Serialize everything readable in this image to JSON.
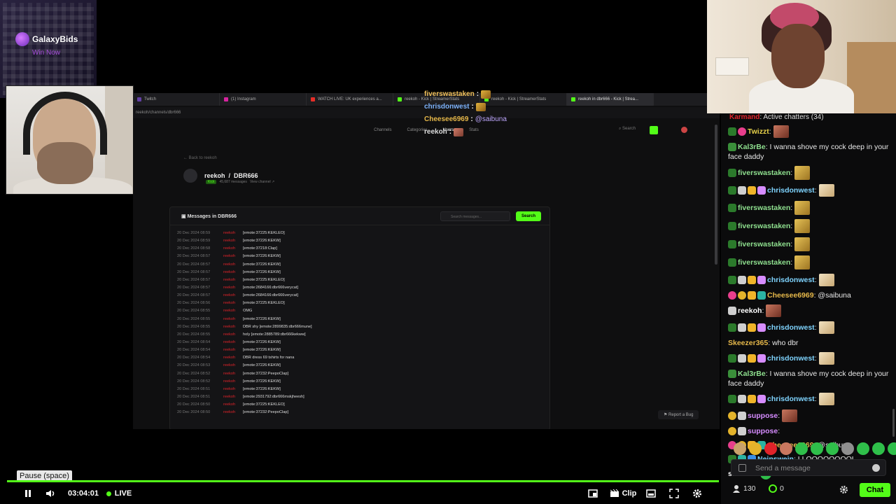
{
  "sponsor": {
    "name": "GalaxyBids",
    "tagline": "Win Now"
  },
  "capture": {
    "tabs": [
      {
        "label": "Twitch",
        "icon": "twitch"
      },
      {
        "label": "(1) Instagram",
        "icon": "instagram"
      },
      {
        "label": "WATCH LIVE: UK experiences a...",
        "icon": "youtube"
      },
      {
        "label": "reekoh - Kick | StreamerStats",
        "icon": "kick"
      },
      {
        "label": "reekoh - Kick | StreamerStats",
        "icon": "kick"
      },
      {
        "label": "reekoh in dbr666 - Kick | Strea...",
        "icon": "kick"
      }
    ],
    "address": "reekoh/channels/dbr666",
    "nav": [
      "Channels",
      "Categories",
      "Users",
      "Stats"
    ],
    "nav_active": "Users",
    "search_label": "Search",
    "back": "← Back to reekoh",
    "user": "reekoh",
    "channel": "DBR666",
    "platform_badge": "Kick",
    "message_count": "45,687 messages",
    "view_channel": "View channel ↗",
    "panel_title": "Messages in DBR666",
    "panel_search_placeholder": "Search messages...",
    "panel_search_button": "Search",
    "rows": [
      {
        "date": "20 Dec 2024 08:59",
        "user": "reekoh",
        "text": "[emote:37225:KEKLEO]"
      },
      {
        "date": "20 Dec 2024 08:59",
        "user": "reekoh",
        "text": "[emote:37226:KEKW]"
      },
      {
        "date": "20 Dec 2024 08:58",
        "user": "reekoh",
        "text": "[emote:37218:Clap]"
      },
      {
        "date": "20 Dec 2024 08:57",
        "user": "reekoh",
        "text": "[emote:37226:KEKW]"
      },
      {
        "date": "20 Dec 2024 08:57",
        "user": "reekoh",
        "text": "[emote:37226:KEKW]"
      },
      {
        "date": "20 Dec 2024 08:57",
        "user": "reekoh",
        "text": "[emote:37226:KEKW]"
      },
      {
        "date": "20 Dec 2024 08:57",
        "user": "reekoh",
        "text": "[emote:37225:KEKLEO]"
      },
      {
        "date": "20 Dec 2024 08:57",
        "user": "reekoh",
        "text": "[emote:2684166:dbr666verycat]"
      },
      {
        "date": "20 Dec 2024 08:57",
        "user": "reekoh",
        "text": "[emote:2684166:dbr666verycat]"
      },
      {
        "date": "20 Dec 2024 08:56",
        "user": "reekoh",
        "text": "[emote:37225:KEKLEO]"
      },
      {
        "date": "20 Dec 2024 08:55",
        "user": "reekoh",
        "text": "OMG"
      },
      {
        "date": "20 Dec 2024 08:55",
        "user": "reekoh",
        "text": "[emote:37226:KEKW]"
      },
      {
        "date": "20 Dec 2024 08:55",
        "user": "reekoh",
        "text": "DBR shy [emote:2899835:dbr666mune]"
      },
      {
        "date": "20 Dec 2024 08:55",
        "user": "reekoh",
        "text": "holy [emote:2885789:dbr666kekww]"
      },
      {
        "date": "20 Dec 2024 08:54",
        "user": "reekoh",
        "text": "[emote:37226:KEKW]"
      },
      {
        "date": "20 Dec 2024 08:54",
        "user": "reekoh",
        "text": "[emote:37226:KEKW]"
      },
      {
        "date": "20 Dec 2024 08:54",
        "user": "reekoh",
        "text": "DBR dress 69 tshirts for nana"
      },
      {
        "date": "20 Dec 2024 08:53",
        "user": "reekoh",
        "text": "[emote:37226:KEKW]"
      },
      {
        "date": "20 Dec 2024 08:52",
        "user": "reekoh",
        "text": "[emote:37232:PeepoClap]"
      },
      {
        "date": "20 Dec 2024 08:52",
        "user": "reekoh",
        "text": "[emote:37226:KEKW]"
      },
      {
        "date": "20 Dec 2024 08:51",
        "user": "reekoh",
        "text": "[emote:37226:KEKW]"
      },
      {
        "date": "20 Dec 2024 08:51",
        "user": "reekoh",
        "text": "[emote:2931792:dbr666mskjheesh]"
      },
      {
        "date": "20 Dec 2024 08:50",
        "user": "reekoh",
        "text": "[emote:37225:KEKLEO]"
      },
      {
        "date": "20 Dec 2024 08:50",
        "user": "reekoh",
        "text": "[emote:37232:PeepoClap]"
      }
    ],
    "report_bug": "Report a Bug"
  },
  "float_chat": [
    {
      "user": "fiverswastaken",
      "text": "",
      "color": "#f0c05a"
    },
    {
      "user": "chrisdonwest",
      "text": "",
      "color": "#7fb5ff"
    },
    {
      "user": "Cheesee6969",
      "text": "@saibuna",
      "color": "#e6b84a"
    },
    {
      "user": "reekoh",
      "text": "",
      "color": "#dcdcdc"
    }
  ],
  "player": {
    "tooltip": "Pause (space)",
    "time": "03:04:01",
    "live": "LIVE",
    "clip": "Clip",
    "progress": 1.0
  },
  "chat": {
    "header": "Active chatters (34)",
    "messages": [
      {
        "user": "Twizzt",
        "color": "#e8d24a",
        "text": "",
        "emote": "red",
        "badges": [
          "sub",
          "pink"
        ]
      },
      {
        "user": "Kal3rBe",
        "color": "#8fe08f",
        "text": "I wanna shove my cock deep in your face daddy",
        "emote": "",
        "badges": [
          "mod"
        ],
        "sep": ": "
      },
      {
        "user": "fiverswastaken",
        "color": "#8fe08f",
        "text": "",
        "emote": "gold",
        "badges": [
          "sub"
        ]
      },
      {
        "user": "chrisdonwest",
        "color": "#7fd4ff",
        "text": "",
        "emote": "face",
        "badges": [
          "sub",
          "white",
          "crown",
          "gift"
        ]
      },
      {
        "user": "fiverswastaken",
        "color": "#8fe08f",
        "text": "",
        "emote": "gold",
        "badges": [
          "sub"
        ]
      },
      {
        "user": "fiverswastaken",
        "color": "#8fe08f",
        "text": "",
        "emote": "gold",
        "badges": [
          "sub"
        ]
      },
      {
        "user": "fiverswastaken",
        "color": "#8fe08f",
        "text": "",
        "emote": "gold",
        "badges": [
          "sub"
        ]
      },
      {
        "user": "fiverswastaken",
        "color": "#8fe08f",
        "text": "",
        "emote": "gold",
        "badges": [
          "sub"
        ]
      },
      {
        "user": "chrisdonwest",
        "color": "#7fd4ff",
        "text": "",
        "emote": "face",
        "badges": [
          "sub",
          "white",
          "crown",
          "gift"
        ]
      },
      {
        "user": "Cheesee6969",
        "color": "#e6b84a",
        "text": "@saibuna",
        "emote": "",
        "badges": [
          "pink",
          "yellow",
          "crown",
          "teal"
        ]
      },
      {
        "user": "reekoh",
        "color": "#ffffff",
        "text": "",
        "emote": "red",
        "badges": [
          "white"
        ]
      },
      {
        "user": "chrisdonwest",
        "color": "#7fd4ff",
        "text": "",
        "emote": "face",
        "badges": [
          "sub",
          "white",
          "crown",
          "gift"
        ]
      },
      {
        "user": "Skeezer365",
        "color": "#e6b84a",
        "text": "who dbr",
        "emote": "",
        "badges": []
      },
      {
        "user": "chrisdonwest",
        "color": "#7fd4ff",
        "text": "",
        "emote": "face",
        "badges": [
          "sub",
          "white",
          "crown",
          "gift"
        ]
      },
      {
        "user": "Kal3rBe",
        "color": "#8fe08f",
        "text": "I wanna shove my cock deep in your face daddy",
        "emote": "",
        "badges": [
          "mod"
        ]
      },
      {
        "user": "chrisdonwest",
        "color": "#7fd4ff",
        "text": "",
        "emote": "face",
        "badges": [
          "sub",
          "white",
          "crown",
          "gift"
        ]
      },
      {
        "user": "suppose",
        "color": "#d68cff",
        "text": "",
        "emote": "red",
        "badges": [
          "yellow",
          "white"
        ]
      },
      {
        "user": "suppose",
        "color": "#d68cff",
        "text": "",
        "emote": "",
        "badges": [
          "yellow",
          "white"
        ]
      },
      {
        "user": "Cheesee6969",
        "color": "#e6b84a",
        "text": "@saibuna",
        "emote": "",
        "badges": [
          "pink",
          "yellow",
          "crown",
          "teal"
        ]
      },
      {
        "user": "Neinswein",
        "color": "#7fd4ff",
        "text": "LLOOOOOOOOL",
        "emote": "",
        "badges": [
          "sub",
          "teal",
          "blue"
        ]
      },
      {
        "user": "saibuna",
        "color": "#ffffff",
        "text": "",
        "emote": "green",
        "badges": []
      }
    ],
    "input_placeholder": "Send a message",
    "viewer_count": "130",
    "points": "0",
    "chat_button": "Chat"
  },
  "colors": {
    "accent": "#53fc18",
    "background": "#000000",
    "chat_bg": "#0b0b0c",
    "red_user": "#e0232a"
  }
}
